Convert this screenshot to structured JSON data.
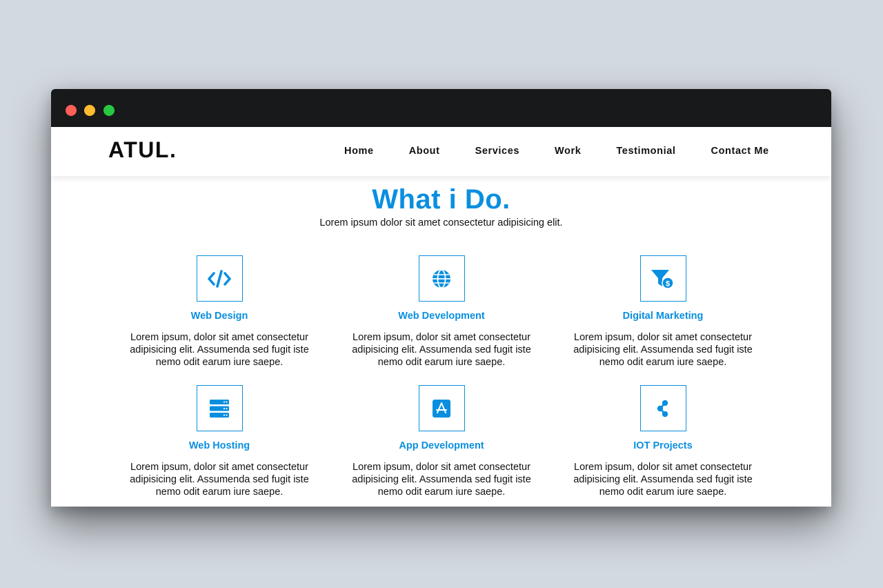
{
  "nav": {
    "brand": "ATUL.",
    "links": [
      "Home",
      "About",
      "Services",
      "Work",
      "Testimonial",
      "Contact Me"
    ]
  },
  "section": {
    "title": "What i Do.",
    "subtitle": "Lorem ipsum dolor sit amet consectetur adipisicing elit."
  },
  "services": [
    {
      "icon": "code-icon",
      "title": "Web Design",
      "desc": "Lorem ipsum, dolor sit amet consectetur adipisicing elit. Assumenda sed fugit iste nemo odit earum iure saepe."
    },
    {
      "icon": "globe-icon",
      "title": "Web Development",
      "desc": "Lorem ipsum, dolor sit amet consectetur adipisicing elit. Assumenda sed fugit iste nemo odit earum iure saepe."
    },
    {
      "icon": "funnel-dollar-icon",
      "title": "Digital Marketing",
      "desc": "Lorem ipsum, dolor sit amet consectetur adipisicing elit. Assumenda sed fugit iste nemo odit earum iure saepe."
    },
    {
      "icon": "server-icon",
      "title": "Web Hosting",
      "desc": "Lorem ipsum, dolor sit amet consectetur adipisicing elit. Assumenda sed fugit iste nemo odit earum iure saepe."
    },
    {
      "icon": "app-store-icon",
      "title": "App Development",
      "desc": "Lorem ipsum, dolor sit amet consectetur adipisicing elit. Assumenda sed fugit iste nemo odit earum iure saepe."
    },
    {
      "icon": "share-nodes-icon",
      "title": "IOT Projects",
      "desc": "Lorem ipsum, dolor sit amet consectetur adipisicing elit. Assumenda sed fugit iste nemo odit earum iure saepe."
    }
  ],
  "colors": {
    "accent": "#0a8fdf",
    "titlebar": "#18191b",
    "backdrop": "#d3d9e0"
  }
}
